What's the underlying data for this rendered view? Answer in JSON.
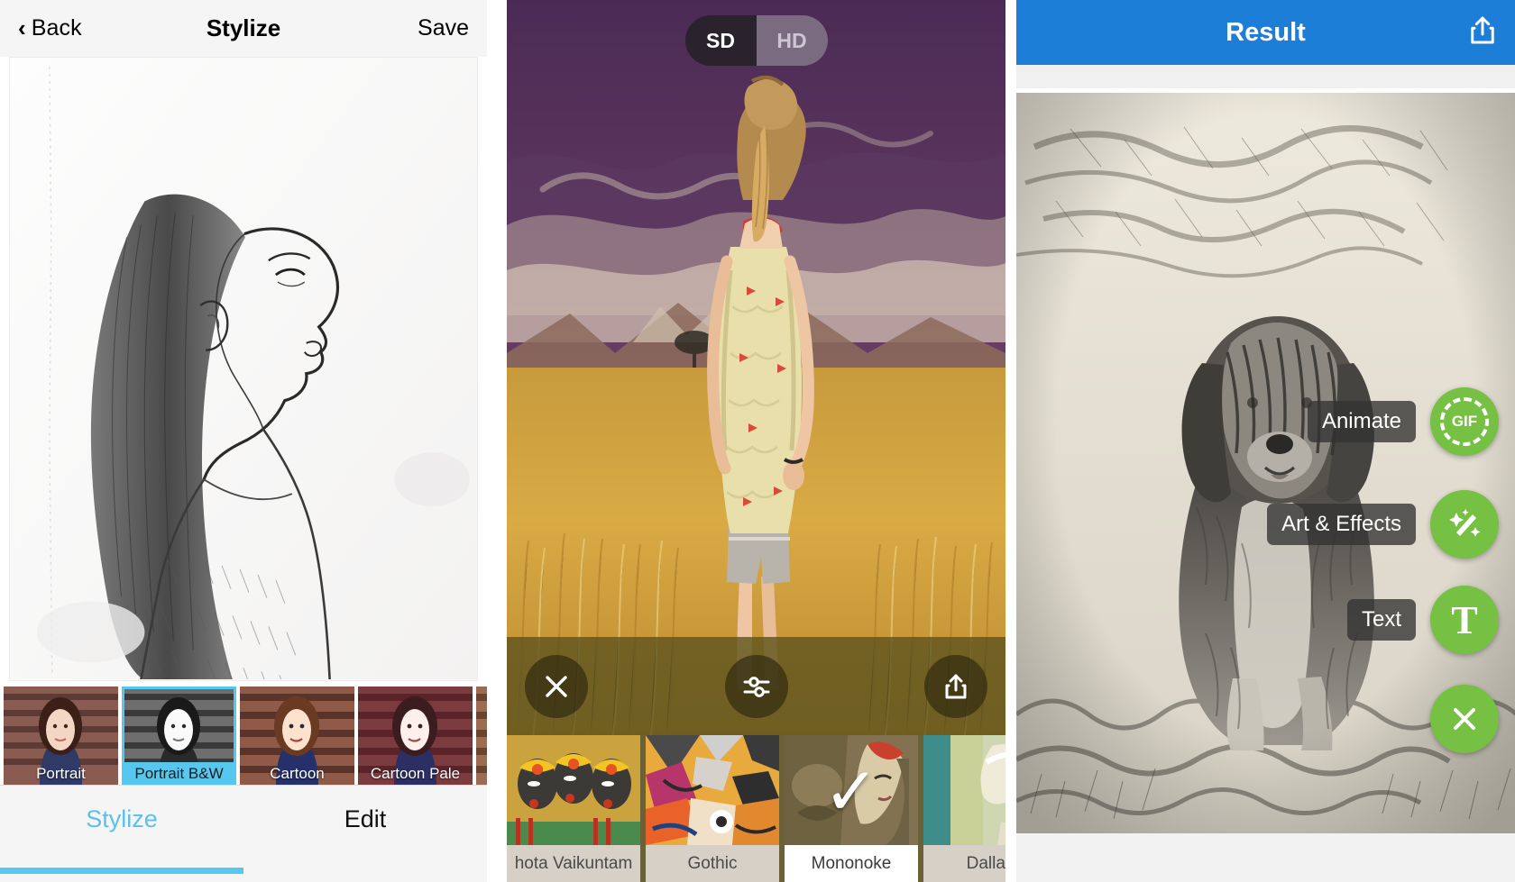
{
  "panel1": {
    "nav": {
      "back_label": "Back",
      "title": "Stylize",
      "save_label": "Save",
      "back_icon": "chevron-left-icon"
    },
    "filters": [
      {
        "label": "Portrait",
        "selected": false
      },
      {
        "label": "Portrait B&W",
        "selected": true
      },
      {
        "label": "Cartoon",
        "selected": false
      },
      {
        "label": "Cartoon Pale",
        "selected": false
      },
      {
        "label": "",
        "selected": false
      }
    ],
    "tabs": [
      {
        "label": "Stylize",
        "active": true
      },
      {
        "label": "Edit",
        "active": false
      }
    ],
    "accent_color": "#56c8ef"
  },
  "panel2": {
    "quality_toggle": {
      "options": [
        "SD",
        "HD"
      ],
      "selected": "SD"
    },
    "toolbar": [
      {
        "name": "close-button",
        "icon": "close-icon"
      },
      {
        "name": "adjust-button",
        "icon": "sliders-icon"
      },
      {
        "name": "share-button",
        "icon": "share-icon"
      }
    ],
    "filters": [
      {
        "label": "hota Vaikuntam",
        "selected": false
      },
      {
        "label": "Gothic",
        "selected": false
      },
      {
        "label": "Mononoke",
        "selected": true
      },
      {
        "label": "Dallas",
        "selected": false
      }
    ]
  },
  "panel3": {
    "nav": {
      "title": "Result",
      "share_icon": "share-icon"
    },
    "actions": [
      {
        "label": "Animate",
        "icon": "gif-icon",
        "glyph": "GIF"
      },
      {
        "label": "Art & Effects",
        "icon": "magic-wand-icon",
        "glyph": "✦"
      },
      {
        "label": "Text",
        "icon": "text-icon",
        "glyph": "T"
      },
      {
        "label": "",
        "icon": "close-icon",
        "glyph": "✕"
      }
    ],
    "header_color": "#1c7ed6",
    "fab_color": "#76c043"
  }
}
